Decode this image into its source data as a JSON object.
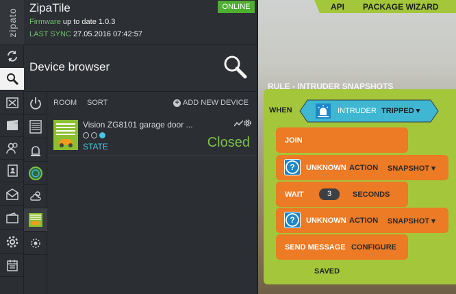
{
  "app": {
    "brand_vertical": "zipato"
  },
  "header": {
    "title": "ZipaTile",
    "firmware_label": "Firmware",
    "firmware_text": "up to date 1.0.3",
    "sync_label": "LAST SYNC",
    "sync_value": "27.05.2016 07:42:57",
    "status": "ONLINE"
  },
  "browser": {
    "title": "Device browser"
  },
  "device_toolbar": {
    "room": "ROOM",
    "sort": "SORT",
    "add": "ADD NEW DEVICE"
  },
  "device": {
    "name": "Vision ZG8101 garage door ...",
    "state_label": "STATE",
    "value": "Closed"
  },
  "rule_editor": {
    "top_buttons": [
      "API",
      "PACKAGE WIZARD"
    ],
    "title": "RULE - INTRUDER SNAPSHOTS",
    "when": "WHEN",
    "trigger_name": "INTRUDER",
    "trigger_state": "TRIPPED",
    "blocks": {
      "join": "JOIN",
      "unknown": "UNKNOWN",
      "action": "ACTION",
      "snapshot": "SNAPSHOT",
      "wait": "WAIT",
      "wait_value": "3",
      "seconds": "SECONDS",
      "send_message": "SEND MESSAGE",
      "configure": "CONFIGURE"
    },
    "saved": "SAVED"
  },
  "colors": {
    "accent_green": "#a4c63b",
    "block_orange": "#ed7a24",
    "trigger_cyan": "#3fb7d2",
    "value_green": "#7cc443",
    "state_blue": "#46c3e8"
  }
}
